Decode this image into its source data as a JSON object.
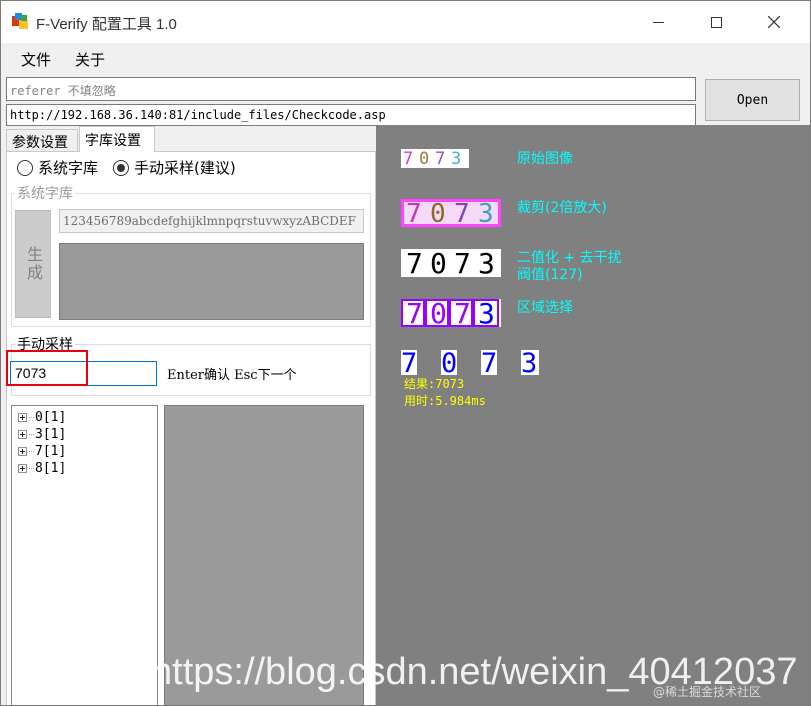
{
  "window": {
    "title": "F-Verify 配置工具 1.0"
  },
  "menu": {
    "file": "文件",
    "about": "关于"
  },
  "inputs": {
    "referer_placeholder": "referer 不填忽略",
    "url_value": "http://192.168.36.140:81/include_files/Checkcode.asp",
    "open_label": "Open"
  },
  "tabs": [
    {
      "label": "参数设置"
    },
    {
      "label": "字库设置",
      "active": true
    }
  ],
  "library_mode": {
    "system_label": "系统字库",
    "manual_label": "手动采样(建议)",
    "selected": "manual"
  },
  "system_library": {
    "title": "系统字库",
    "generate_label": "生成",
    "charset": "123456789abcdefghijklmnpqrstuvwxyzABCDEF"
  },
  "manual_sampling": {
    "title": "手动采样",
    "value": "7073",
    "hint": "Enter确认 Esc下一个"
  },
  "tree": {
    "items": [
      "0[1]",
      "3[1]",
      "7[1]",
      "8[1]"
    ]
  },
  "results": {
    "original_label": "原始图像",
    "crop_label": "裁剪(2倍放大)",
    "binarize_label_1": "二值化 + 去干扰",
    "binarize_label_2": "阀值(127)",
    "region_label": "区域选择",
    "result_text": "结果:7073",
    "time_text": "用时:5.984ms",
    "captcha_digits": [
      "7",
      "0",
      "7",
      "3"
    ]
  },
  "watermark": {
    "url": "https://blog.csdn.net/weixin_40412037",
    "tag": "@稀土掘金技术社区"
  },
  "colors": {
    "right_panel": "#808080",
    "label_cyan": "#00ffff",
    "result_yellow": "#ffff00",
    "highlight_red": "#e60012",
    "selection_blue": "#0000ff",
    "region_purple": "#9900ff",
    "crop_magenta": "#ff44ff"
  }
}
